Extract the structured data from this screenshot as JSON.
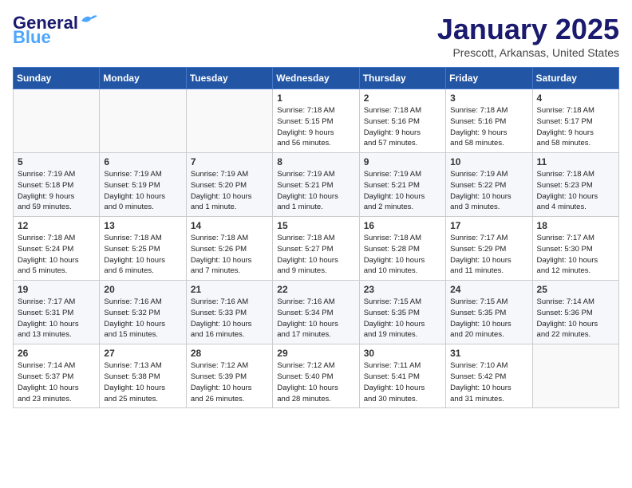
{
  "header": {
    "logo_line1": "General",
    "logo_line2": "Blue",
    "month_title": "January 2025",
    "location": "Prescott, Arkansas, United States"
  },
  "weekdays": [
    "Sunday",
    "Monday",
    "Tuesday",
    "Wednesday",
    "Thursday",
    "Friday",
    "Saturday"
  ],
  "weeks": [
    [
      {
        "day": "",
        "info": ""
      },
      {
        "day": "",
        "info": ""
      },
      {
        "day": "",
        "info": ""
      },
      {
        "day": "1",
        "info": "Sunrise: 7:18 AM\nSunset: 5:15 PM\nDaylight: 9 hours\nand 56 minutes."
      },
      {
        "day": "2",
        "info": "Sunrise: 7:18 AM\nSunset: 5:16 PM\nDaylight: 9 hours\nand 57 minutes."
      },
      {
        "day": "3",
        "info": "Sunrise: 7:18 AM\nSunset: 5:16 PM\nDaylight: 9 hours\nand 58 minutes."
      },
      {
        "day": "4",
        "info": "Sunrise: 7:18 AM\nSunset: 5:17 PM\nDaylight: 9 hours\nand 58 minutes."
      }
    ],
    [
      {
        "day": "5",
        "info": "Sunrise: 7:19 AM\nSunset: 5:18 PM\nDaylight: 9 hours\nand 59 minutes."
      },
      {
        "day": "6",
        "info": "Sunrise: 7:19 AM\nSunset: 5:19 PM\nDaylight: 10 hours\nand 0 minutes."
      },
      {
        "day": "7",
        "info": "Sunrise: 7:19 AM\nSunset: 5:20 PM\nDaylight: 10 hours\nand 1 minute."
      },
      {
        "day": "8",
        "info": "Sunrise: 7:19 AM\nSunset: 5:21 PM\nDaylight: 10 hours\nand 1 minute."
      },
      {
        "day": "9",
        "info": "Sunrise: 7:19 AM\nSunset: 5:21 PM\nDaylight: 10 hours\nand 2 minutes."
      },
      {
        "day": "10",
        "info": "Sunrise: 7:19 AM\nSunset: 5:22 PM\nDaylight: 10 hours\nand 3 minutes."
      },
      {
        "day": "11",
        "info": "Sunrise: 7:18 AM\nSunset: 5:23 PM\nDaylight: 10 hours\nand 4 minutes."
      }
    ],
    [
      {
        "day": "12",
        "info": "Sunrise: 7:18 AM\nSunset: 5:24 PM\nDaylight: 10 hours\nand 5 minutes."
      },
      {
        "day": "13",
        "info": "Sunrise: 7:18 AM\nSunset: 5:25 PM\nDaylight: 10 hours\nand 6 minutes."
      },
      {
        "day": "14",
        "info": "Sunrise: 7:18 AM\nSunset: 5:26 PM\nDaylight: 10 hours\nand 7 minutes."
      },
      {
        "day": "15",
        "info": "Sunrise: 7:18 AM\nSunset: 5:27 PM\nDaylight: 10 hours\nand 9 minutes."
      },
      {
        "day": "16",
        "info": "Sunrise: 7:18 AM\nSunset: 5:28 PM\nDaylight: 10 hours\nand 10 minutes."
      },
      {
        "day": "17",
        "info": "Sunrise: 7:17 AM\nSunset: 5:29 PM\nDaylight: 10 hours\nand 11 minutes."
      },
      {
        "day": "18",
        "info": "Sunrise: 7:17 AM\nSunset: 5:30 PM\nDaylight: 10 hours\nand 12 minutes."
      }
    ],
    [
      {
        "day": "19",
        "info": "Sunrise: 7:17 AM\nSunset: 5:31 PM\nDaylight: 10 hours\nand 13 minutes."
      },
      {
        "day": "20",
        "info": "Sunrise: 7:16 AM\nSunset: 5:32 PM\nDaylight: 10 hours\nand 15 minutes."
      },
      {
        "day": "21",
        "info": "Sunrise: 7:16 AM\nSunset: 5:33 PM\nDaylight: 10 hours\nand 16 minutes."
      },
      {
        "day": "22",
        "info": "Sunrise: 7:16 AM\nSunset: 5:34 PM\nDaylight: 10 hours\nand 17 minutes."
      },
      {
        "day": "23",
        "info": "Sunrise: 7:15 AM\nSunset: 5:35 PM\nDaylight: 10 hours\nand 19 minutes."
      },
      {
        "day": "24",
        "info": "Sunrise: 7:15 AM\nSunset: 5:35 PM\nDaylight: 10 hours\nand 20 minutes."
      },
      {
        "day": "25",
        "info": "Sunrise: 7:14 AM\nSunset: 5:36 PM\nDaylight: 10 hours\nand 22 minutes."
      }
    ],
    [
      {
        "day": "26",
        "info": "Sunrise: 7:14 AM\nSunset: 5:37 PM\nDaylight: 10 hours\nand 23 minutes."
      },
      {
        "day": "27",
        "info": "Sunrise: 7:13 AM\nSunset: 5:38 PM\nDaylight: 10 hours\nand 25 minutes."
      },
      {
        "day": "28",
        "info": "Sunrise: 7:12 AM\nSunset: 5:39 PM\nDaylight: 10 hours\nand 26 minutes."
      },
      {
        "day": "29",
        "info": "Sunrise: 7:12 AM\nSunset: 5:40 PM\nDaylight: 10 hours\nand 28 minutes."
      },
      {
        "day": "30",
        "info": "Sunrise: 7:11 AM\nSunset: 5:41 PM\nDaylight: 10 hours\nand 30 minutes."
      },
      {
        "day": "31",
        "info": "Sunrise: 7:10 AM\nSunset: 5:42 PM\nDaylight: 10 hours\nand 31 minutes."
      },
      {
        "day": "",
        "info": ""
      }
    ]
  ]
}
